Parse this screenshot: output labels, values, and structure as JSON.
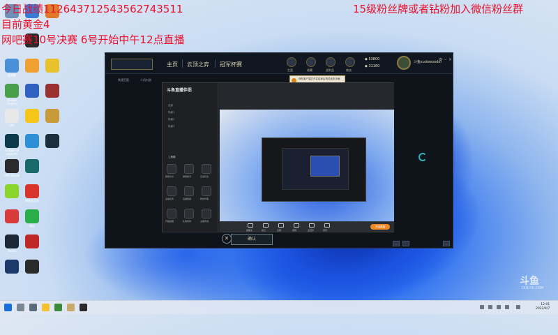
{
  "overlay": {
    "line1": "今日战绩11264371254356274351​1",
    "line2": "目前黄金4",
    "line3": "网吧赛10号决赛 6号开始中午12点直播",
    "right": "15级粉丝牌或者钻粉加入微信粉丝群"
  },
  "desktop_icons": [
    {
      "label": "回收站",
      "color": "#6f8fb8"
    },
    {
      "label": "",
      "color": "#3a7bd5"
    },
    {
      "label": "",
      "color": "#e07a2a"
    },
    {
      "label": "",
      "color": "#2a2a2a"
    },
    {
      "label": "此电脑",
      "color": "#4a90d9"
    },
    {
      "label": "",
      "color": "#f0a030"
    },
    {
      "label": "",
      "color": "#e9c12a"
    },
    {
      "label": "Google Chrome",
      "color": "#4aa04a"
    },
    {
      "label": "",
      "color": "#3060c0"
    },
    {
      "label": "",
      "color": "#9a3030"
    },
    {
      "label": "",
      "color": "#f5c518"
    },
    {
      "label": "QQ",
      "color": "#e8e8e8"
    },
    {
      "label": "",
      "color": "#c89a3a"
    },
    {
      "label": "League of Legends",
      "color": "#0b3a4a"
    },
    {
      "label": "",
      "color": "#2d8fd6"
    },
    {
      "label": "",
      "color": "#1a2f3c"
    },
    {
      "label": "OBS Studio",
      "color": "#2a2a2a"
    },
    {
      "label": "",
      "color": "#186a6a"
    },
    {
      "label": "",
      "color": "#8bd42c"
    },
    {
      "label": "网易云音乐",
      "color": "#d9342b"
    },
    {
      "label": "",
      "color": "#d93a3a"
    },
    {
      "label": "微信",
      "color": "#2aae4a"
    },
    {
      "label": "Steam",
      "color": "#1b2838"
    },
    {
      "label": "",
      "color": "#c02828"
    },
    {
      "label": "",
      "color": "#1b3a6a"
    },
    {
      "label": "",
      "color": "#2a2a2a"
    }
  ],
  "client": {
    "nav": [
      "主页",
      "云顶之弈",
      "冠军杯赛"
    ],
    "subnav": [
      "快速匹配",
      "人机对战",
      "",
      "",
      "",
      ""
    ],
    "top_icons": [
      "生涯",
      "收藏",
      "战利品",
      "商店"
    ],
    "currency_be": "53800",
    "currency_rp": "31160",
    "username": "斗鱼zudowoodoi",
    "tip_text": "请在客户端打开并结束后再关闭本页面",
    "confirm_label": "确认",
    "close_symbol": "✕"
  },
  "stream_app": {
    "logo": "斗鱼直播伴侣",
    "tab_title": "全部",
    "scene_rows": [
      "场景1",
      "场景2",
      "场景3"
    ],
    "tools_label": "工具箱",
    "tools": [
      "屏幕共享",
      "弹幕助手",
      "互动玩法",
      "主播任务",
      "直播数据",
      "粉丝管理",
      "开播提醒",
      "礼物特效",
      "主播商城"
    ],
    "bottom_tools": [
      "摄像头",
      "窗口",
      "全屏",
      "游戏",
      "麦克风",
      "音乐"
    ],
    "start_label": "开始直播"
  },
  "taskbar": {
    "time": "12:01",
    "date": "2022/4/7"
  },
  "watermark": {
    "logo": "斗鱼",
    "sub": "DOUYU.COM"
  },
  "colors": {
    "overlay_text": "#e8102b",
    "accent_orange": "#f08a24",
    "lol_gold": "#c8aa6e"
  }
}
